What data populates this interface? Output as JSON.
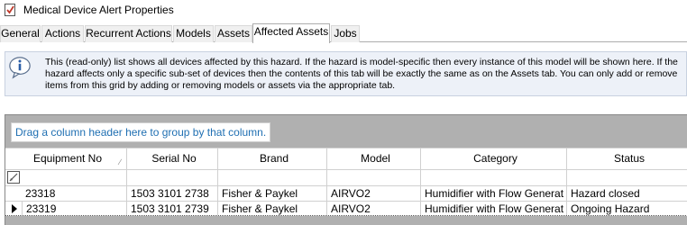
{
  "window": {
    "title": "Medical Device Alert Properties"
  },
  "tabs": [
    {
      "label": "General"
    },
    {
      "label": "Actions"
    },
    {
      "label": "Recurrent Actions"
    },
    {
      "label": "Models"
    },
    {
      "label": "Assets"
    },
    {
      "label": "Affected Assets",
      "active": true
    },
    {
      "label": "Jobs"
    }
  ],
  "info": {
    "text": "This (read-only) list shows all devices affected by this hazard. If the hazard is model-specific then every instance of this model will be shown here. If the hazard affects only a specific sub-set of devices then the contents of this tab will be exactly the same as on the Assets tab. You can only add or remove items from this grid by adding or removing models or assets via the appropriate tab."
  },
  "grid": {
    "group_hint": "Drag a column header here to group by that column.",
    "columns": [
      "Equipment No",
      "Serial No",
      "Brand",
      "Model",
      "Category",
      "Status"
    ],
    "rows": [
      [
        "23318",
        "1503 3101 2738",
        "Fisher & Paykel",
        "AIRVO2",
        "Humidifier with Flow Generat",
        "Hazard closed"
      ],
      [
        "23319",
        "1503 3101 2739",
        "Fisher & Paykel",
        "AIRVO2",
        "Humidifier with Flow Generat",
        "Ongoing Hazard"
      ]
    ]
  },
  "colors": {
    "link_blue": "#1f6fb2",
    "info_bg": "#edf1f8",
    "grid_bg": "#b0b0b0"
  }
}
